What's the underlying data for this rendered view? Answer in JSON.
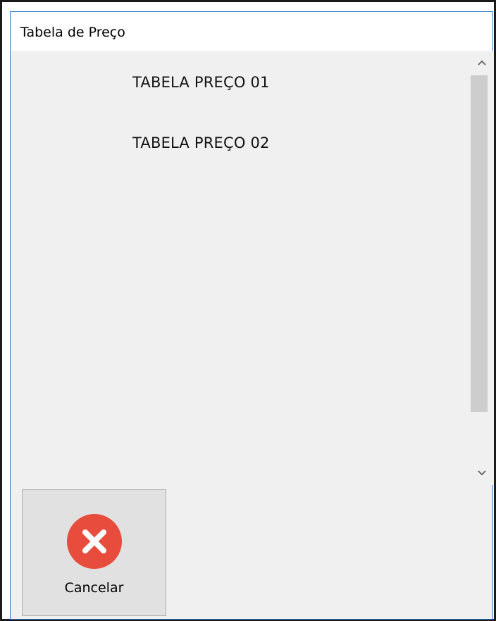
{
  "window": {
    "title": "Tabela de Preço"
  },
  "list": {
    "items": [
      {
        "label": "TABELA PREÇO 01"
      },
      {
        "label": "TABELA PREÇO 02"
      }
    ]
  },
  "scrollbar": {
    "up_icon": "chevron-up-icon",
    "down_icon": "chevron-down-icon"
  },
  "actions": {
    "cancel_label": "Cancelar",
    "cancel_icon": "close-circle-icon",
    "cancel_color": "#e84c3d"
  },
  "colors": {
    "window_border": "#2b7bd0",
    "background": "#f0f0f0",
    "scroll_thumb": "#cdcdcd"
  }
}
